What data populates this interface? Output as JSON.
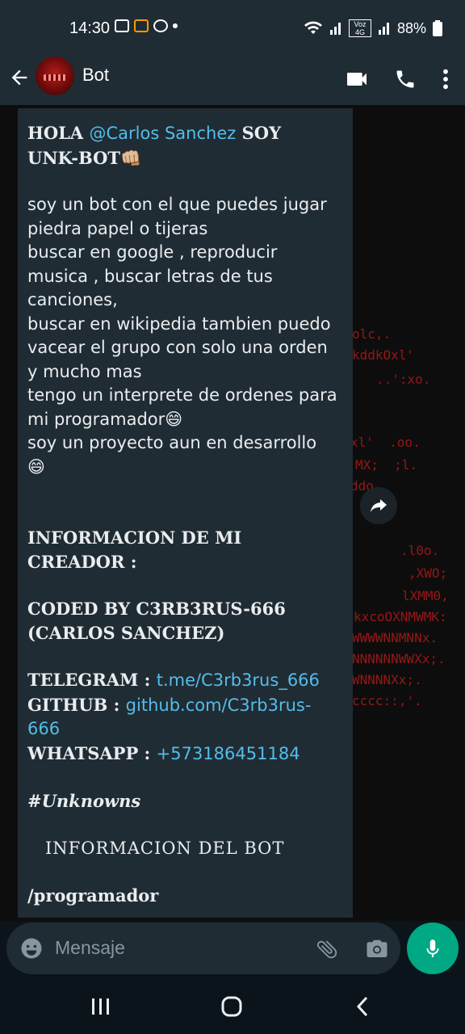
{
  "status": {
    "time": "14:30",
    "battery": "88%",
    "network": "Voz 4G"
  },
  "header": {
    "back_icon": "arrow-left-icon",
    "title": "Bot",
    "actions": [
      "video-call-icon",
      "phone-icon",
      "more-vert-icon"
    ]
  },
  "message": {
    "greeting_prefix": "HOLA ",
    "mention": "@Carlos Sanchez",
    "greeting_suffix": " SOY",
    "bot_name": "UNK-BOT👊🏼",
    "intro_lines": [
      "soy un bot  con el que puedes jugar",
      "piedra papel o tijeras",
      "buscar en google , reproducir",
      "musica , buscar letras de tus",
      "canciones,",
      "buscar en wikipedia tambien puedo",
      "vacear el grupo con solo una orden",
      "y mucho mas",
      "tengo un interprete de ordenes para",
      "mi programador😄",
      "soy un proyecto aun en desarrollo",
      "😄"
    ],
    "creator_heading": "INFORMACION DE MI CREADOR :",
    "coded_by_line1": "CODED BY C3RB3RUS-666",
    "coded_by_line2": "(CARLOS SANCHEZ)",
    "telegram_label": "TELEGRAM : ",
    "telegram_link": "t.me/C3rb3rus_666",
    "github_label": "GITHUB : ",
    "github_link": "github.com/C3rb3rus-666",
    "whatsapp_label": "WHATSAPP : ",
    "whatsapp_link": "+573186451184",
    "hashtag": "#Unknowns",
    "bot_info_heading": "INFORMACION DEL BOT",
    "command": "/programador"
  },
  "wallpaper_text": [
    "olc,.",
    "kddkOxl'",
    "..':xo.",
    "xl'  .oo.",
    "MX;  ;l.",
    "ddo",
    ".l0o.",
    ",XWO;",
    "lXMM0,",
    "kxcoOXNMWMK:",
    "WWWWNNMNNx.",
    "NNNNNNWWXx;.",
    "WNNNNXx;.",
    "cccc::,'."
  ],
  "composer": {
    "placeholder": "Mensaje",
    "emoji_icon": "emoji-icon",
    "attach_icon": "paperclip-icon",
    "camera_icon": "camera-icon",
    "mic_icon": "mic-icon"
  },
  "navigation": [
    "recent-apps-icon",
    "home-icon",
    "back-icon"
  ],
  "colors": {
    "header_bg": "#1f2c34",
    "bubble_bg": "#202c33",
    "link": "#53bdeb",
    "mic_bg": "#00a884"
  }
}
